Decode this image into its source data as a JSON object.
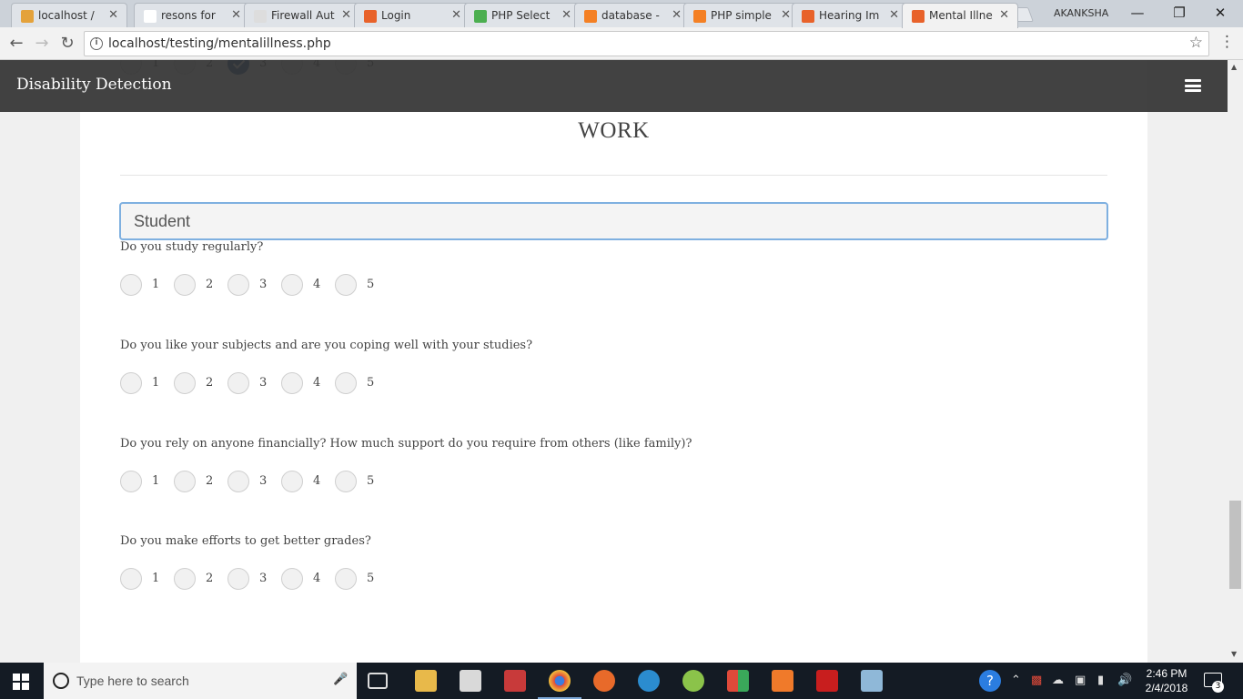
{
  "browser": {
    "tabs": [
      {
        "title": "localhost /",
        "favicon_color": "#e4a23b"
      },
      {
        "title": "resons for",
        "favicon_color": "#ffffff"
      },
      {
        "title": "Firewall Aut",
        "favicon_color": "#dddddd"
      },
      {
        "title": "Login",
        "favicon_color": "#e8622a"
      },
      {
        "title": "PHP Select",
        "favicon_color": "#4caf50"
      },
      {
        "title": "database -",
        "favicon_color": "#f48024"
      },
      {
        "title": "PHP simple",
        "favicon_color": "#f48024"
      },
      {
        "title": "Hearing Im",
        "favicon_color": "#e8622a"
      },
      {
        "title": "Mental Illne",
        "favicon_color": "#e8622a"
      }
    ],
    "profile_name": "AKANKSHA",
    "url": "localhost/testing/mentalillness.php"
  },
  "page": {
    "brand": "Disability Detection",
    "section_title": "WORK",
    "occupation_select_value": "Student",
    "scale_options": [
      "1",
      "2",
      "3",
      "4",
      "5"
    ],
    "partial_previous_selected": 3,
    "questions": [
      {
        "text": "Do you study regularly?",
        "selected": null
      },
      {
        "text": "Do you like your subjects and are you coping well with your studies?",
        "selected": null
      },
      {
        "text": "Do you rely on anyone financially? How much support do you require from others (like family)?",
        "selected": null
      },
      {
        "text": "Do you make efforts to get better grades?",
        "selected": null
      }
    ],
    "accent_color": "#1e5a9a"
  },
  "taskbar": {
    "search_placeholder": "Type here to search",
    "time": "2:46 PM",
    "date": "2/4/2018",
    "notification_count": "3"
  }
}
